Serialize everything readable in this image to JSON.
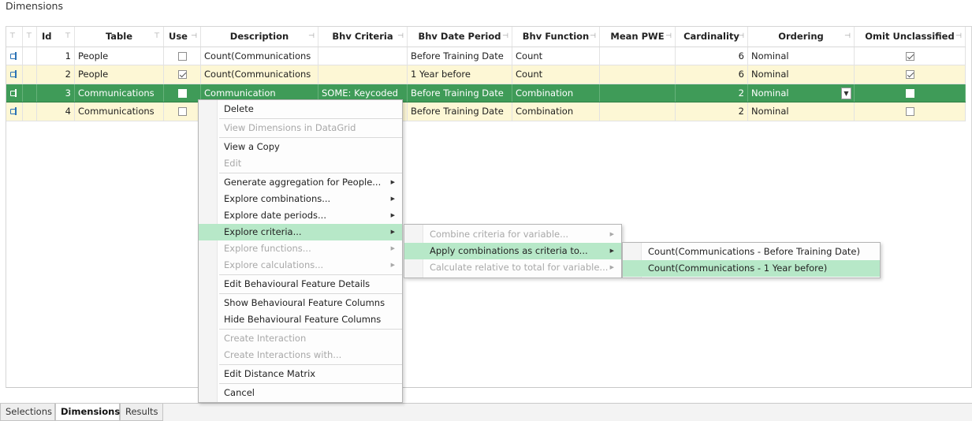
{
  "panel_title": "Dimensions",
  "columns": {
    "c1": "",
    "c2": "",
    "id": "Id",
    "table": "Table",
    "use": "Use",
    "description": "Description",
    "bhv_criteria": "Bhv Criteria",
    "bhv_date_period": "Bhv Date Period",
    "bhv_function": "Bhv Function",
    "mean_pwe": "Mean PWE",
    "cardinality": "Cardinality",
    "ordering": "Ordering",
    "omit_unclassified": "Omit Unclassified"
  },
  "rows": [
    {
      "id": "1",
      "table": "People",
      "use": false,
      "description": "Count(Communications",
      "bhv_criteria": "",
      "bhv_date_period": "Before Training Date",
      "bhv_function": "Count",
      "mean_pwe": "",
      "cardinality": "6",
      "ordering": "Nominal",
      "omit_unclassified": true
    },
    {
      "id": "2",
      "table": "People",
      "use": true,
      "description": "Count(Communications",
      "bhv_criteria": "",
      "bhv_date_period": "1 Year before",
      "bhv_function": "Count",
      "mean_pwe": "",
      "cardinality": "6",
      "ordering": "Nominal",
      "omit_unclassified": true
    },
    {
      "id": "3",
      "table": "Communications",
      "use": false,
      "description": "Communication",
      "bhv_criteria": "SOME: Keycoded",
      "bhv_date_period": "Before Training Date",
      "bhv_function": "Combination",
      "mean_pwe": "",
      "cardinality": "2",
      "ordering": "Nominal",
      "omit_unclassified": false
    },
    {
      "id": "4",
      "table": "Communications",
      "use": false,
      "description": "",
      "bhv_criteria": "",
      "bhv_date_period": "Before Training Date",
      "bhv_function": "Combination",
      "mean_pwe": "",
      "cardinality": "2",
      "ordering": "Nominal",
      "omit_unclassified": false
    }
  ],
  "context_menu": {
    "delete": "Delete",
    "view_dimensions": "View Dimensions in DataGrid",
    "view_copy": "View a Copy",
    "edit": "Edit",
    "generate_aggregation": "Generate aggregation for People...",
    "explore_combinations": "Explore combinations...",
    "explore_date_periods": "Explore date periods...",
    "explore_criteria": "Explore criteria...",
    "explore_functions": "Explore functions...",
    "explore_calculations": "Explore calculations...",
    "edit_bf_details": "Edit Behavioural Feature Details",
    "show_bf_columns": "Show Behavioural Feature Columns",
    "hide_bf_columns": "Hide Behavioural Feature Columns",
    "create_interaction": "Create Interaction",
    "create_interactions_with": "Create Interactions with...",
    "edit_distance_matrix": "Edit Distance Matrix",
    "cancel": "Cancel"
  },
  "submenu_criteria": {
    "combine": "Combine criteria for variable...",
    "apply": "Apply combinations as criteria to...",
    "calculate": "Calculate relative to total for variable..."
  },
  "submenu_apply": {
    "item1": "Count(Communications - Before Training Date)",
    "item2": "Count(Communications - 1 Year before)"
  },
  "tabs": [
    "Selections",
    "Dimensions",
    "Results"
  ],
  "active_tab": "Dimensions",
  "colors": {
    "selected_row": "#3f9b58",
    "alt_row": "#fdf7d5",
    "menu_highlight": "#b7e8c8"
  }
}
